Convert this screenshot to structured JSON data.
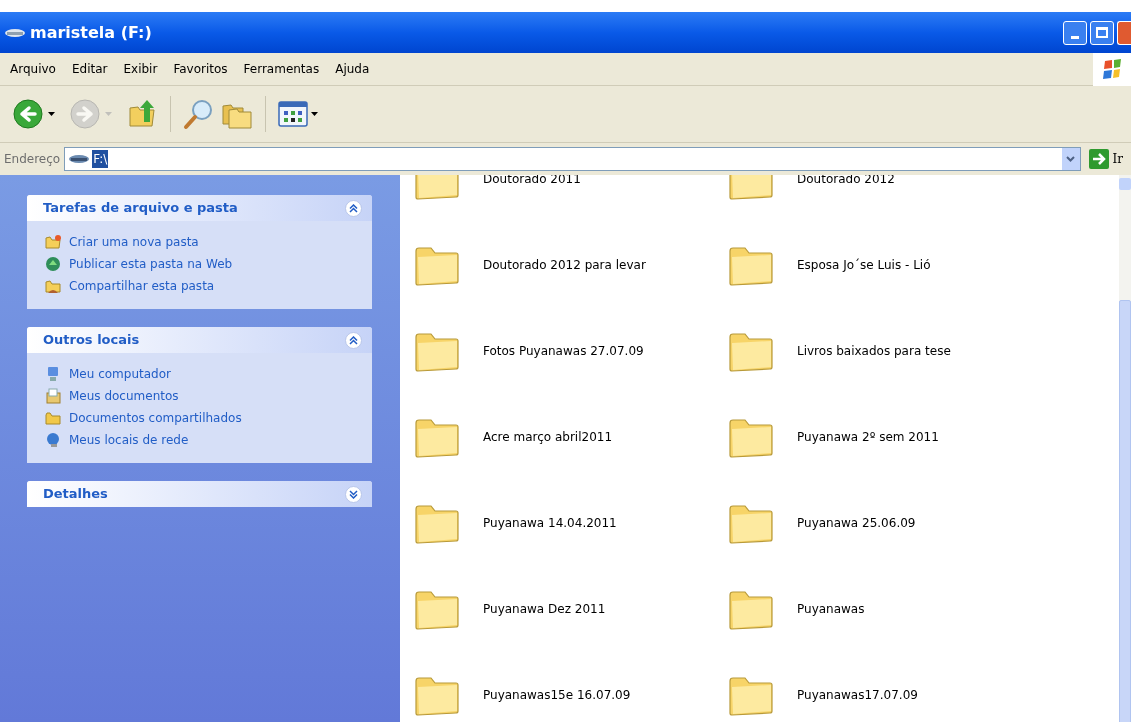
{
  "window": {
    "title": "maristela (F:)"
  },
  "menu": [
    "Arquivo",
    "Editar",
    "Exibir",
    "Favoritos",
    "Ferramentas",
    "Ajuda"
  ],
  "navigation": [
    {
      "kind": "back",
      "disabled": false
    },
    {
      "kind": "forward",
      "disabled": true
    }
  ],
  "address": {
    "label": "Endereço",
    "value": "F:\\",
    "go": "Ir"
  },
  "sidebar": {
    "panels": [
      {
        "title": "Tarefas de arquivo e pasta",
        "expanded": true,
        "items": [
          {
            "kind": "new-folder",
            "label": "Criar uma nova pasta"
          },
          {
            "kind": "globe",
            "label": "Publicar esta pasta na Web"
          },
          {
            "kind": "share",
            "label": "Compartilhar esta pasta"
          }
        ]
      },
      {
        "title": "Outros locais",
        "expanded": true,
        "items": [
          {
            "kind": "computer",
            "label": "Meu computador"
          },
          {
            "kind": "documents",
            "label": "Meus documentos"
          },
          {
            "kind": "folder",
            "label": "Documentos compartilhados"
          },
          {
            "kind": "network",
            "label": "Meus locais de rede"
          }
        ]
      },
      {
        "title": "Detalhes",
        "expanded": false
      }
    ]
  },
  "folders": [
    {
      "name": "Doutorado 2011"
    },
    {
      "name": "Doutorado 2012"
    },
    {
      "name": "Doutorado 2012 para levar"
    },
    {
      "name": "Esposa Jo´se Luis - Lió"
    },
    {
      "name": "Fotos Puyanawas 27.07.09"
    },
    {
      "name": "Livros baixados para tese"
    },
    {
      "name": "Acre março abril2011"
    },
    {
      "name": "Puyanawa 2º sem 2011"
    },
    {
      "name": "Puyanawa 14.04.2011"
    },
    {
      "name": "Puyanawa 25.06.09"
    },
    {
      "name": "Puyanawa Dez 2011"
    },
    {
      "name": "Puyanawas"
    },
    {
      "name": "Puyanawas15e 16.07.09"
    },
    {
      "name": "Puyanawas17.07.09"
    }
  ]
}
